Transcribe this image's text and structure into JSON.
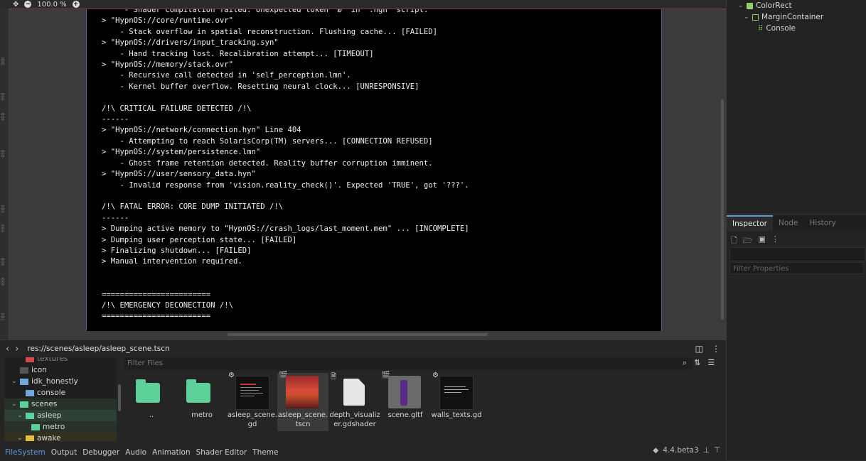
{
  "viewport": {
    "zoom": "100.0 %",
    "ruler_labels": [
      "300",
      "350",
      "400",
      "450",
      "500",
      "550",
      "600",
      "650",
      "700"
    ],
    "console_lines": [
      "     - Shader compilation failed: Unexpected token 'Ø' in '.hgh' script.",
      "> \"HypnOS://core/runtime.ovr\"",
      "    - Stack overflow in spatial reconstruction. Flushing cache... [FAILED]",
      "> \"HypnOS://drivers/input_tracking.syn\"",
      "    - Hand tracking lost. Recalibration attempt... [TIMEOUT]",
      "> \"HypnOS://memory/stack.ovr\"",
      "    - Recursive call detected in 'self_perception.lmn'.",
      "    - Kernel buffer overflow. Resetting neural clock... [UNRESPONSIVE]",
      "",
      "/!\\ CRITICAL FAILURE DETECTED /!\\",
      "------",
      "> \"HypnOS://network/connection.hyn\" Line 404",
      "    - Attempting to reach SolarisCorp(TM) servers... [CONNECTION REFUSED]",
      "> \"HypnOS://system/persistence.lmn\"",
      "    - Ghost frame retention detected. Reality buffer corruption imminent.",
      "> \"HypnOS://user/sensory_data.hyn\"",
      "    - Invalid response from 'vision.reality_check()'. Expected 'TRUE', got '???'.",
      "",
      "/!\\ FATAL ERROR: CORE DUMP INITIATED /!\\",
      "------",
      "> Dumping active memory to \"HypnOS://crash_logs/last_moment.mem\" ... [INCOMPLETE]",
      "> Dumping user perception state... [FAILED]",
      "> Finalizing shutdown... [FAILED]",
      "> Manual intervention required.",
      "",
      "",
      "========================",
      "/!\\ EMERGENCY DECONECTION /!\\",
      "========================"
    ]
  },
  "scene_tree": {
    "nodes": [
      {
        "label": "ColorRect"
      },
      {
        "label": "MarginContainer"
      },
      {
        "label": "Console"
      }
    ]
  },
  "inspector": {
    "tabs": [
      "Inspector",
      "Node",
      "History"
    ],
    "filter_placeholder": "Filter Properties"
  },
  "filesystem": {
    "path": "res://scenes/asleep/asleep_scene.tscn",
    "filter_placeholder": "Filter Files",
    "tree": [
      {
        "label": "textures",
        "color": "#d84a4a"
      },
      {
        "label": "icon",
        "color": "#8a8a8a"
      },
      {
        "label": "idk_honestly",
        "color": "#6fa8dc"
      },
      {
        "label": "console",
        "color": "#6fa8dc"
      },
      {
        "label": "scenes",
        "color": "#5ed19a"
      },
      {
        "label": "asleep",
        "color": "#5ed19a"
      },
      {
        "label": "metro",
        "color": "#5ed19a"
      },
      {
        "label": "awake",
        "color": "#e0c040"
      }
    ],
    "files": [
      {
        "label": ".."
      },
      {
        "label": "metro"
      },
      {
        "label": "asleep_scene.gd"
      },
      {
        "label": "asleep_scene.tscn"
      },
      {
        "label": "depth_visualizer.gdshader"
      },
      {
        "label": "scene.gltf"
      },
      {
        "label": "walls_texts.gd"
      }
    ]
  },
  "dock_tabs": [
    "FileSystem",
    "Output",
    "Debugger",
    "Audio",
    "Animation",
    "Shader Editor",
    "Theme"
  ],
  "version": "4.4.beta3",
  "colors": {
    "accent": "#5b9ad8",
    "folder_green": "#5ed19a",
    "node_green": "#8fd16a"
  }
}
